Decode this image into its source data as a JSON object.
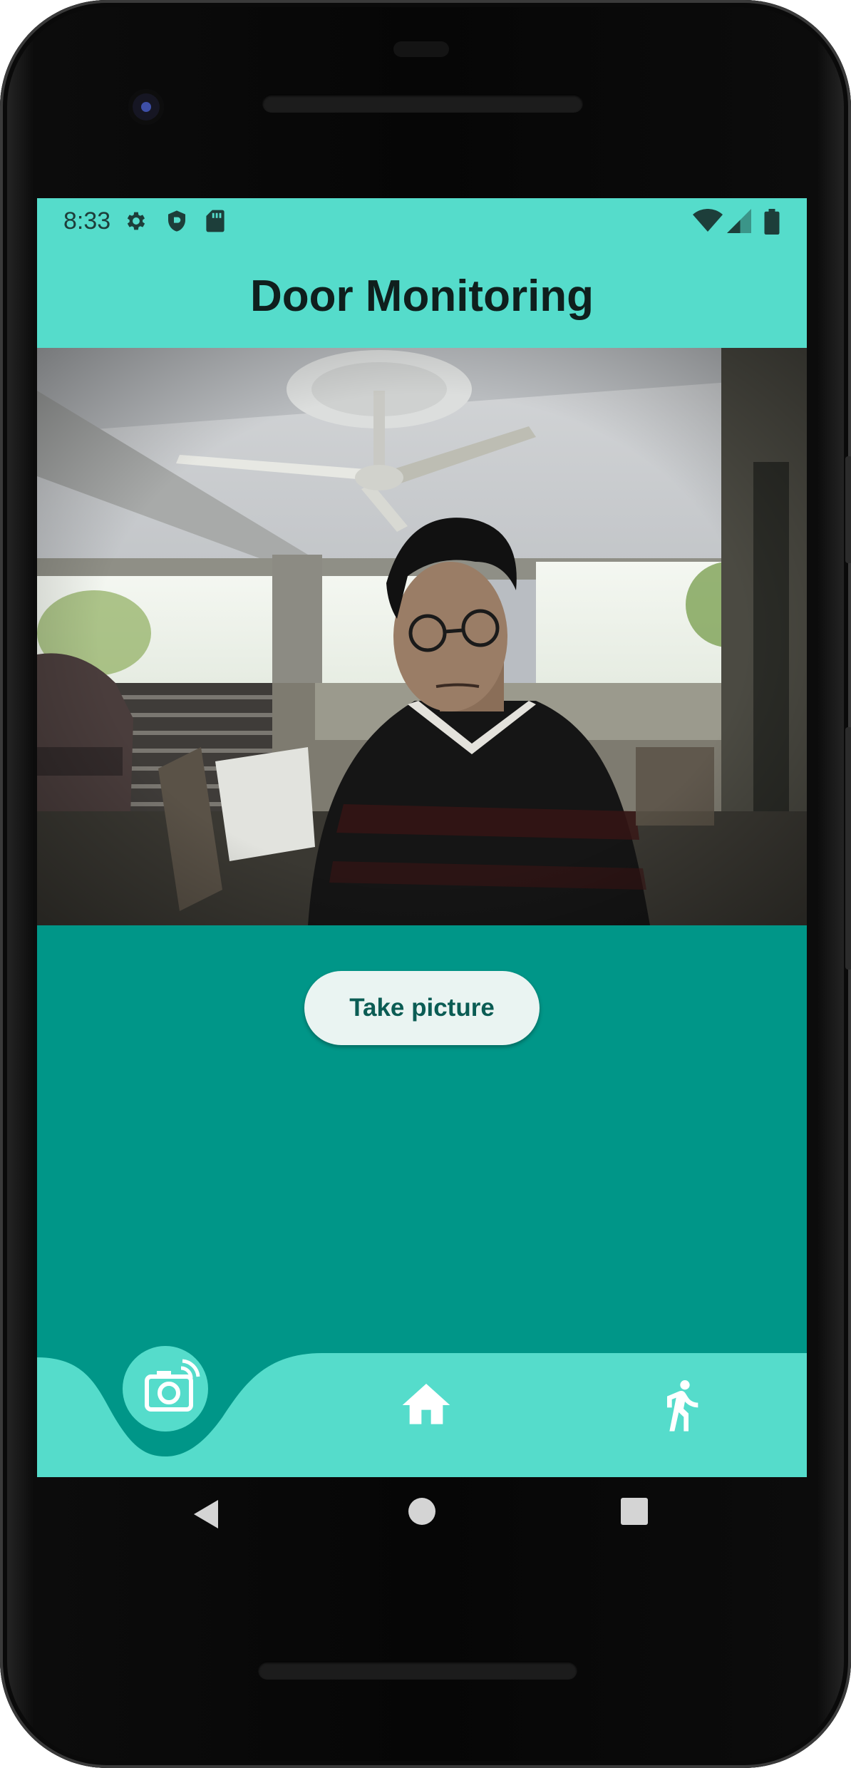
{
  "status_bar": {
    "time": "8:33",
    "left_icons": [
      "gear-icon",
      "shield-icon",
      "sd-card-icon"
    ],
    "right_icons": [
      "wifi-icon",
      "cell-signal-icon",
      "battery-icon"
    ]
  },
  "app_bar": {
    "title": "Door Monitoring"
  },
  "camera_preview": {
    "description": "live-camera-feed"
  },
  "actions": {
    "take_picture_label": "Take picture"
  },
  "bottom_nav": {
    "items": [
      {
        "icon": "camera-icon",
        "selected": true
      },
      {
        "icon": "home-icon",
        "selected": false
      },
      {
        "icon": "running-person-icon",
        "selected": false
      }
    ]
  },
  "system_nav": [
    "back-icon",
    "home-circle-icon",
    "recents-icon"
  ],
  "colors": {
    "accent": "#55dccb",
    "background": "#009688",
    "button_text": "#0b5c54"
  }
}
